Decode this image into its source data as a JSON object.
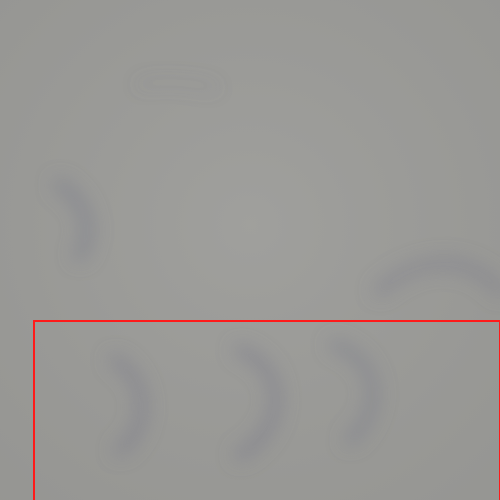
{
  "image": {
    "background_color": "#9c9c99",
    "ink_color": "#7e7f8c"
  },
  "selection": {
    "color": "#ff1a1a"
  }
}
